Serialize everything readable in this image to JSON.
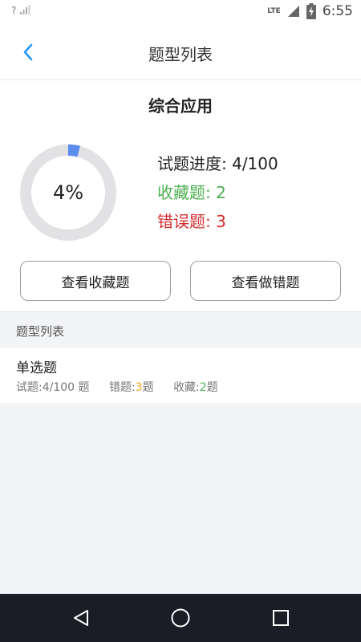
{
  "status_bar": {
    "signal_text": "?",
    "network": "LTE",
    "time": "6:55"
  },
  "header": {
    "title": "题型列表",
    "back_icon": "chevron-left-icon"
  },
  "summary": {
    "category_title": "综合应用",
    "progress_percent": 4,
    "progress_text": "4%",
    "progress_label": "试题进度: 4/100",
    "favorites_label": "收藏题: 2",
    "errors_label": "错误题: 3",
    "view_favorites_button": "查看收藏题",
    "view_errors_button": "查看做错题"
  },
  "section": {
    "title": "题型列表"
  },
  "question_types": [
    {
      "title": "单选题",
      "progress_text": "试题:4/100 题",
      "errors_prefix": "错题:",
      "errors_count": "3",
      "errors_suffix": "题",
      "favorites_prefix": "收藏:",
      "favorites_count": "2",
      "favorites_suffix": "题"
    }
  ],
  "colors": {
    "progress_arc": "#5b8def",
    "progress_track": "#e2e2e4",
    "accent_blue": "#2196f3",
    "favorites_green": "#4caf50",
    "errors_red": "#d32f2f",
    "errors_count_orange": "#f5a623"
  },
  "nav_bar": {
    "back_icon": "triangle-back-icon",
    "home_icon": "circle-home-icon",
    "recent_icon": "square-recents-icon"
  }
}
